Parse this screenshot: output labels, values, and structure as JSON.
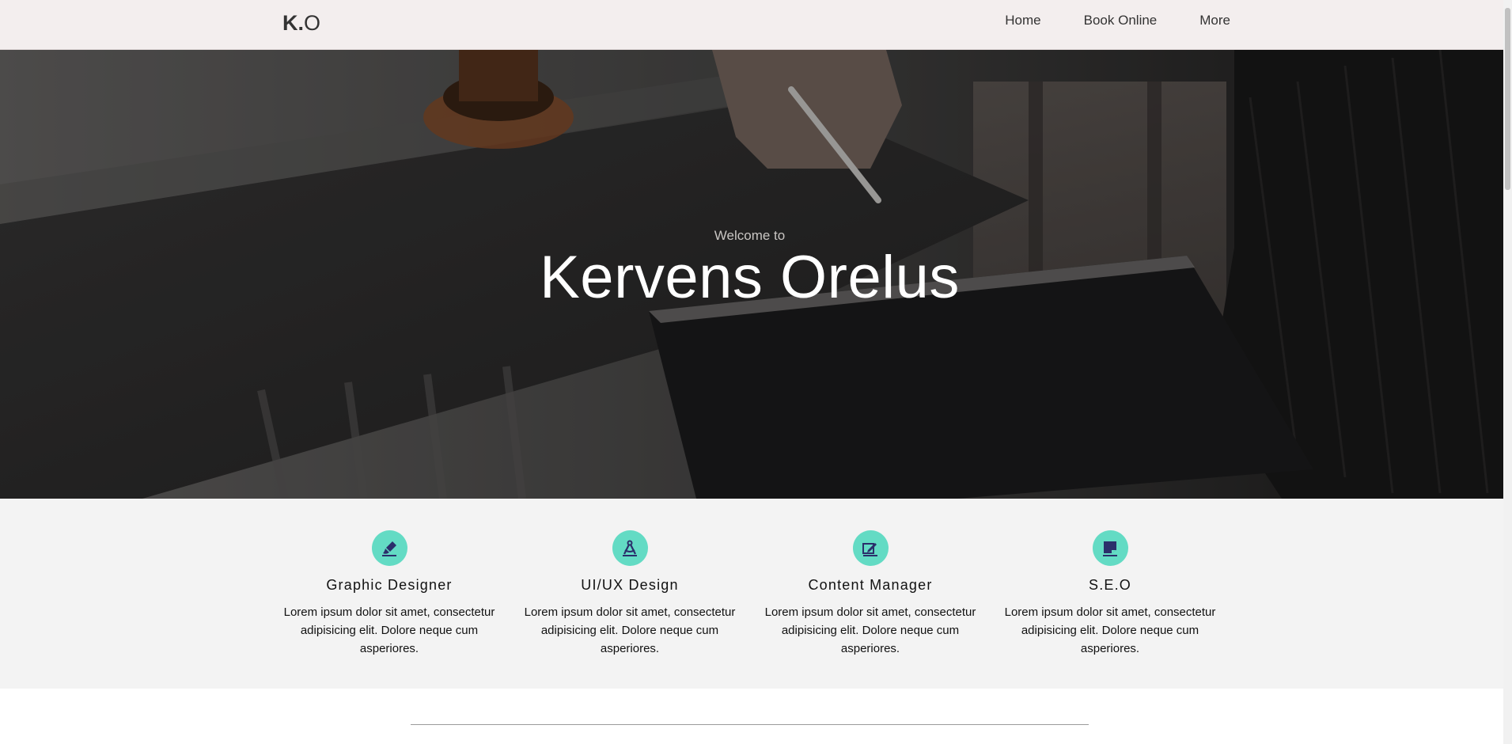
{
  "nav": {
    "logo_k": "K",
    "logo_dot": ".",
    "logo_o": "O",
    "links": [
      "Home",
      "Book Online",
      "More"
    ]
  },
  "hero": {
    "subtitle": "Welcome to",
    "title": "Kervens Orelus"
  },
  "services": [
    {
      "icon": "brush-icon",
      "title": "Graphic Designer",
      "desc": "Lorem ipsum dolor sit amet, consectetur adipisicing elit. Dolore neque cum asperiores."
    },
    {
      "icon": "compass-icon",
      "title": "UI/UX Design",
      "desc": "Lorem ipsum dolor sit amet, consectetur adipisicing elit. Dolore neque cum asperiores."
    },
    {
      "icon": "edit-icon",
      "title": "Content Manager",
      "desc": "Lorem ipsum dolor sit amet, consectetur adipisicing elit. Dolore neque cum asperiores."
    },
    {
      "icon": "note-icon",
      "title": "S.E.O",
      "desc": "Lorem ipsum dolor sit amet, consectetur adipisicing elit. Dolore neque cum asperiores."
    }
  ],
  "colors": {
    "navbar_bg": "#f3eeee",
    "accent": "#63dbc4",
    "services_bg": "#f3f3f3",
    "icon_glyph": "#2b2f6b"
  }
}
